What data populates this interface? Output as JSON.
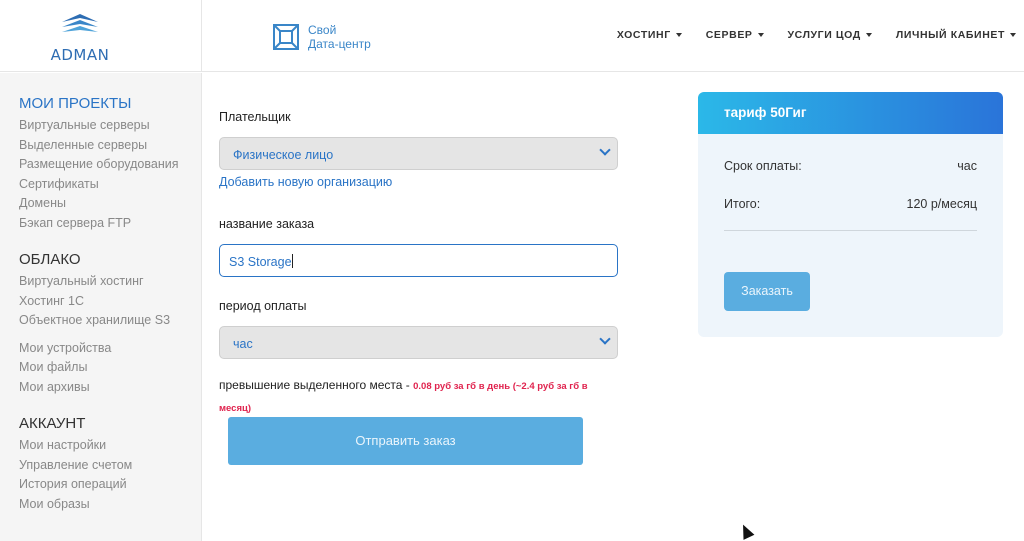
{
  "header": {
    "brand": "ADMAN",
    "datacenter": {
      "line1": "Свой",
      "line2": "Дата-центр"
    },
    "nav": [
      {
        "label": "ХОСТИНГ"
      },
      {
        "label": "СЕРВЕР"
      },
      {
        "label": "УСЛУГИ ЦОД"
      },
      {
        "label": "ЛИЧНЫЙ КАБИНЕТ"
      }
    ]
  },
  "sidebar": {
    "groups": [
      {
        "title": "МОИ ПРОЕКТЫ",
        "items": [
          "Виртуальные серверы",
          "Выделенные серверы",
          "Размещение оборудования",
          "Сертификаты",
          "Домены",
          "Бэкап сервера FTP"
        ]
      },
      {
        "title": "ОБЛАКО",
        "items": [
          "Виртуальный хостинг",
          "Хостинг 1С",
          "Объектное хранилище S3"
        ],
        "items2": [
          "Мои устройства",
          "Мои файлы",
          "Мои архивы"
        ]
      },
      {
        "title": "АККАУНТ",
        "items": [
          "Мои настройки",
          "Управление счетом",
          "История операций",
          "Мои образы"
        ]
      }
    ]
  },
  "form": {
    "payer_label": "Плательщик",
    "payer_value": "Физическое лицо",
    "add_org_link": "Добавить новую организацию",
    "order_name_label": "название заказа",
    "order_name_value": "S3 Storage",
    "period_label": "период оплаты",
    "period_value": "час",
    "excess_label": "превышение выделенного места - ",
    "excess_rate_1": "0.08 руб за гб в день (~2.4 руб за гб в",
    "excess_rate_2": "месяц)",
    "submit_label": "Отправить заказ"
  },
  "tariff": {
    "title": "тариф 50Гиг",
    "term_label": "Срок оплаты:",
    "term_value": "час",
    "total_label": "Итого:",
    "total_value": "120 р/месяц",
    "order_button": "Заказать"
  },
  "colors": {
    "accent": "#2a74c6",
    "button": "#5aade0",
    "warning": "#e0234e"
  }
}
